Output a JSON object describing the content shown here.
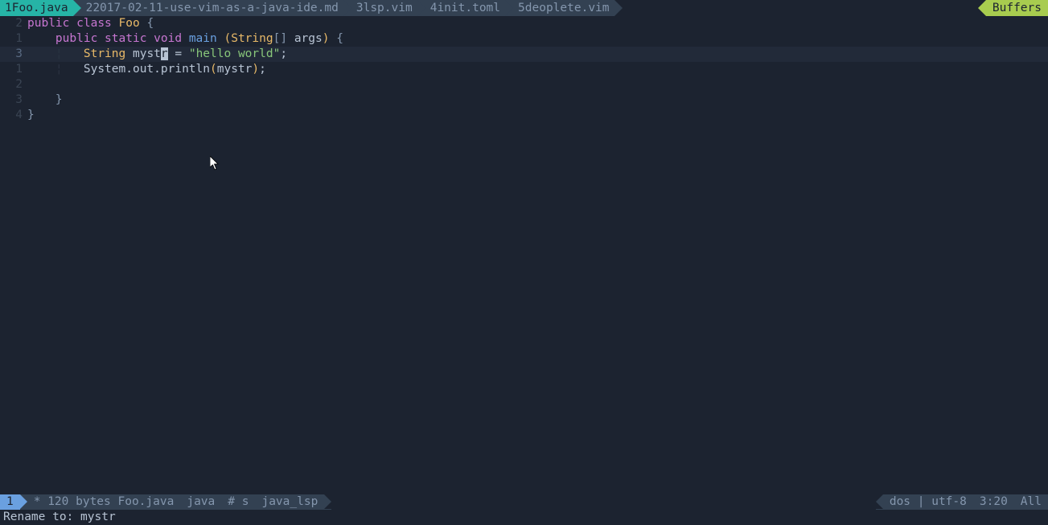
{
  "tabs": [
    {
      "num": "1",
      "name": "Foo.java",
      "active": true
    },
    {
      "num": "2",
      "name": "2017-02-11-use-vim-as-a-java-ide.md",
      "active": false
    },
    {
      "num": "3",
      "name": "lsp.vim",
      "active": false
    },
    {
      "num": "4",
      "name": "init.toml",
      "active": false
    },
    {
      "num": "5",
      "name": "deoplete.vim",
      "active": false
    }
  ],
  "buffers_label": "Buffers",
  "lines": {
    "l1_gutter": "2",
    "l2_gutter": "1",
    "l3_gutter": "3",
    "l4_gutter": "1",
    "l5_gutter": "2",
    "l6_gutter": "3",
    "l7_gutter": "4"
  },
  "code": {
    "public": "public",
    "class": "class",
    "foo": "Foo",
    "static": "static",
    "void": "void",
    "main": "main",
    "string": "String",
    "args": "args",
    "brackets": "[]",
    "stringtype": "String",
    "mystr_pre": "myst",
    "mystr_cur": "r",
    "eq": " = ",
    "hello": "\"hello world\"",
    "semi": ";",
    "sysout": "System.out.println",
    "mystr2": "mystr",
    "lbrace": "{",
    "rbrace": "}",
    "lparen": "(",
    "rparen": ")"
  },
  "statusline": {
    "mode": "1",
    "fileinfo": "* 120 bytes Foo.java",
    "filetype": "java",
    "branch": "# s",
    "lsp": "java_lsp",
    "enc_sep": "dos | utf-8",
    "pos": "3:20",
    "pct": "All"
  },
  "cmdline": "Rename to: mystr"
}
